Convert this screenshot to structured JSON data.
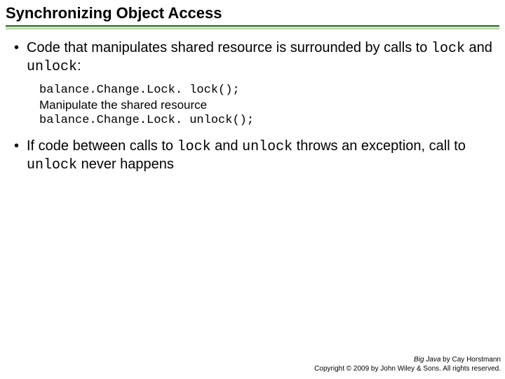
{
  "title": "Synchronizing Object Access",
  "bullets": {
    "b1": {
      "pre": "Code that manipulates shared resource is surrounded by calls to ",
      "code1": "lock",
      "mid": " and ",
      "code2": "unlock",
      "post": ":"
    },
    "b2": {
      "pre": "If code between calls to ",
      "code1": "lock",
      "mid": " and ",
      "code2": "unlock",
      "post1": " throws an exception, call to ",
      "code3": "unlock",
      "post2": " never happens"
    }
  },
  "code": {
    "line1": "balance.Change.Lock. lock();",
    "line2": "Manipulate the shared resource",
    "line3": "balance.Change.Lock. unlock();"
  },
  "footer": {
    "book": "Big Java",
    "by": " by Cay Horstmann",
    "copyright": "Copyright © 2009 by John Wiley & Sons.  All rights reserved."
  }
}
